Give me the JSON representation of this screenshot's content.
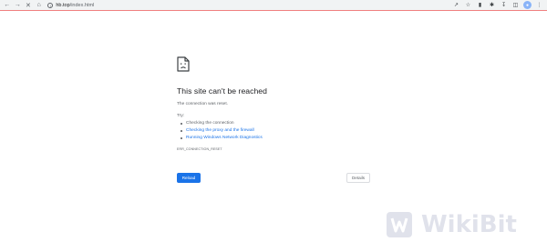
{
  "browser": {
    "url_host": "hb.top",
    "url_path": "/index.html",
    "nav": {
      "back_icon": "arrow-left-icon",
      "forward_icon": "arrow-right-icon",
      "stop_icon": "close-icon",
      "home_icon": "home-icon"
    },
    "toolbar_icons": [
      "share-icon",
      "star-icon",
      "extension-icon",
      "puzzle-icon",
      "download-icon",
      "sidepanel-icon",
      "profile-icon",
      "menu-icon"
    ]
  },
  "error": {
    "title": "This site can't be reached",
    "summary": "The connection was reset.",
    "try_label": "Try:",
    "suggestions": [
      {
        "text": "Checking the connection",
        "link": false
      },
      {
        "text": "Checking the proxy and the firewall",
        "link": true
      },
      {
        "text": "Running Windows Network Diagnostics",
        "link": true
      }
    ],
    "code": "ERR_CONNECTION_RESET",
    "reload_label": "Reload",
    "details_label": "Details"
  },
  "watermark": {
    "text": "WikiBit"
  },
  "colors": {
    "accent": "#1a73e8",
    "toolbar_border": "#f08080",
    "text_primary": "#202124",
    "text_secondary": "#5f6368"
  }
}
